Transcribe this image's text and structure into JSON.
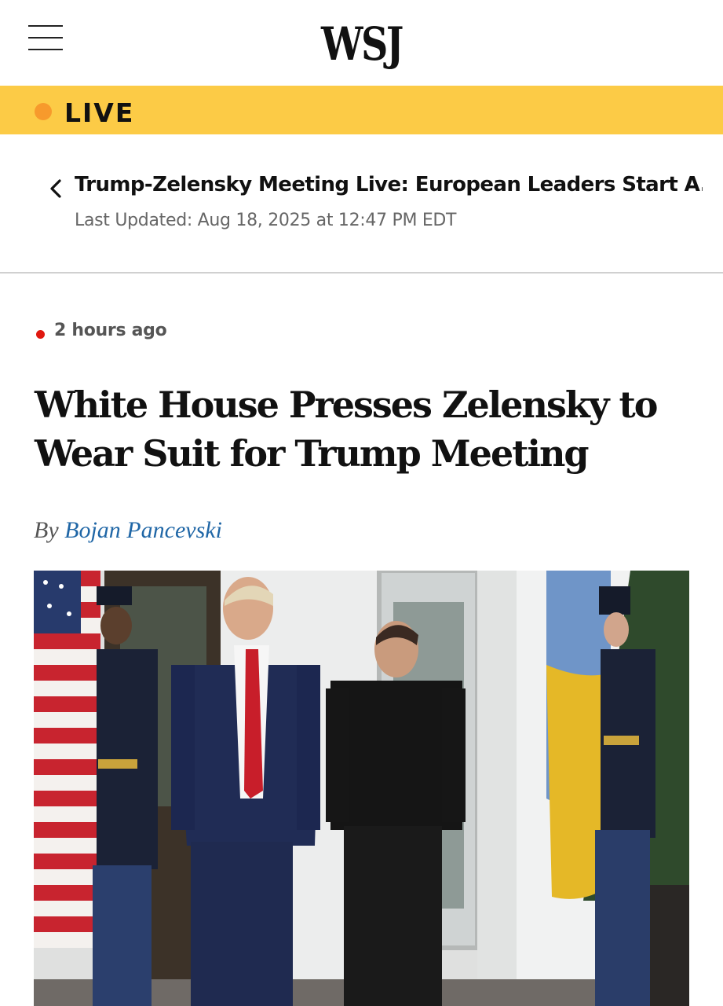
{
  "header": {
    "menu_icon": "hamburger-menu-icon",
    "logo": "WSJ"
  },
  "live_banner": {
    "label": "LIVE",
    "dot_color": "#f79a2c",
    "background": "#fccb46"
  },
  "live_coverage": {
    "back_icon": "chevron-left-icon",
    "title": "Trump-Zelensky Meeting Live: European Leaders Start A...",
    "last_updated": "Last Updated: Aug 18, 2025 at 12:47 PM EDT"
  },
  "article": {
    "time_ago": "2 hours ago",
    "headline": "White House Presses Zelensky to Wear Suit for Trump Meeting",
    "byline_prefix": "By",
    "author": "Bojan Pancevski",
    "author_color": "#1f66a6",
    "photo_icon": "news-photo"
  }
}
